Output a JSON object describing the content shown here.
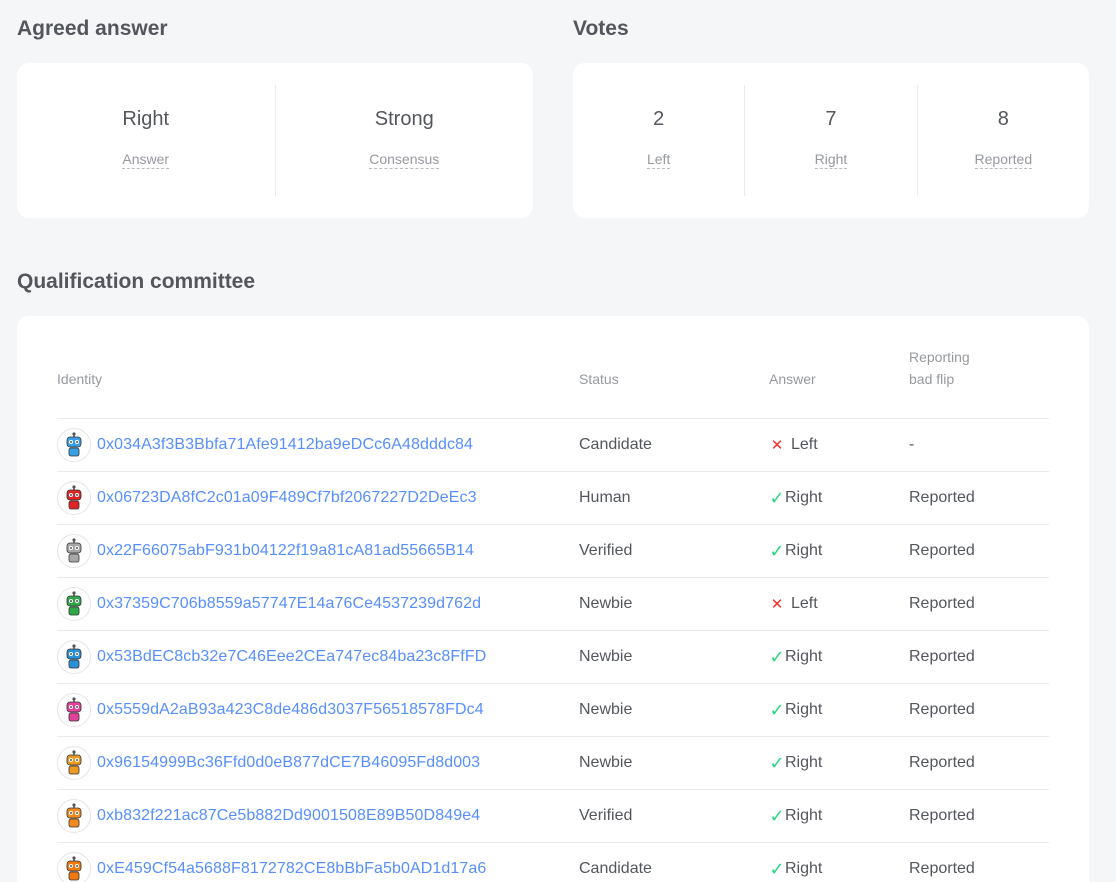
{
  "agreed": {
    "title": "Agreed answer",
    "items": [
      {
        "value": "Right",
        "label": "Answer"
      },
      {
        "value": "Strong",
        "label": "Consensus"
      }
    ]
  },
  "votes": {
    "title": "Votes",
    "items": [
      {
        "value": "2",
        "label": "Left"
      },
      {
        "value": "7",
        "label": "Right"
      },
      {
        "value": "8",
        "label": "Reported"
      }
    ]
  },
  "committee": {
    "title": "Qualification committee",
    "headers": {
      "identity": "Identity",
      "status": "Status",
      "answer": "Answer",
      "reporting_line1": "Reporting",
      "reporting_line2": "bad flip"
    },
    "rows": [
      {
        "address": "0x034A3f3B3Bbfa71Afe91412ba9eDCc6A48dddc84",
        "status": "Candidate",
        "answer": "Left",
        "mark": "cross-icon",
        "reported": "-",
        "avatar_color": "#3aa0e6"
      },
      {
        "address": "0x06723DA8fC2c01a09F489Cf7bf2067227D2DeEc3",
        "status": "Human",
        "answer": "Right",
        "mark": "check-icon",
        "reported": "Reported",
        "avatar_color": "#e02424"
      },
      {
        "address": "0x22F66075abF931b04122f19a81cA81ad55665B14",
        "status": "Verified",
        "answer": "Right",
        "mark": "check-icon",
        "reported": "Reported",
        "avatar_color": "#a8a8a8"
      },
      {
        "address": "0x37359C706b8559a57747E14a76Ce4537239d762d",
        "status": "Newbie",
        "answer": "Left",
        "mark": "cross-icon",
        "reported": "Reported",
        "avatar_color": "#2fa84a"
      },
      {
        "address": "0x53BdEC8cb32e7C46Eee2CEa747ec84ba23c8FfFD",
        "status": "Newbie",
        "answer": "Right",
        "mark": "check-icon",
        "reported": "Reported",
        "avatar_color": "#2b8fd6"
      },
      {
        "address": "0x5559dA2aB93a423C8de486d3037F56518578FDc4",
        "status": "Newbie",
        "answer": "Right",
        "mark": "check-icon",
        "reported": "Reported",
        "avatar_color": "#e0419a"
      },
      {
        "address": "0x96154999Bc36Ffd0d0eB877dCE7B46095Fd8d003",
        "status": "Newbie",
        "answer": "Right",
        "mark": "check-icon",
        "reported": "Reported",
        "avatar_color": "#e89a22"
      },
      {
        "address": "0xb832f221ac87Ce5b882Dd9001508E89B50D849e4",
        "status": "Verified",
        "answer": "Right",
        "mark": "check-icon",
        "reported": "Reported",
        "avatar_color": "#f08a1c"
      },
      {
        "address": "0xE459Cf54a5688F8172782CE8bBbFa5b0AD1d17a6",
        "status": "Candidate",
        "answer": "Right",
        "mark": "check-icon",
        "reported": "Reported",
        "avatar_color": "#f07a10"
      }
    ]
  },
  "colors": {
    "link": "#578fff",
    "check": "#27d980",
    "cross": "#ff2f2f"
  }
}
